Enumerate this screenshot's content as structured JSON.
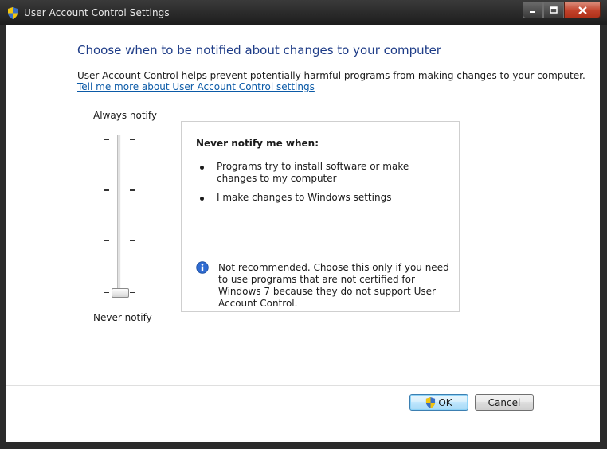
{
  "window": {
    "title": "User Account Control Settings",
    "icon": "uac-shield-icon"
  },
  "controls": {
    "minimize": "minimize-icon",
    "maximize": "maximize-icon",
    "close": "close-icon"
  },
  "main": {
    "heading": "Choose when to be notified about changes to your computer",
    "description": "User Account Control helps prevent potentially harmful programs from making changes to your computer.",
    "link": "Tell me more about User Account Control settings"
  },
  "slider": {
    "top_label": "Always notify",
    "bottom_label": "Never notify",
    "levels": 4,
    "selected_level": 1
  },
  "infobox": {
    "title": "Never notify me when:",
    "bullets": [
      "Programs try to install software or make changes to my computer",
      "I make changes to Windows settings"
    ],
    "note": "Not recommended. Choose this only if you need to use programs that are not certified for Windows 7 because they do not support User Account Control."
  },
  "buttons": {
    "ok": "OK",
    "cancel": "Cancel"
  },
  "colors": {
    "heading": "#1e3c87",
    "link": "#0b5aa7",
    "ok_border": "#3c7fb1"
  }
}
